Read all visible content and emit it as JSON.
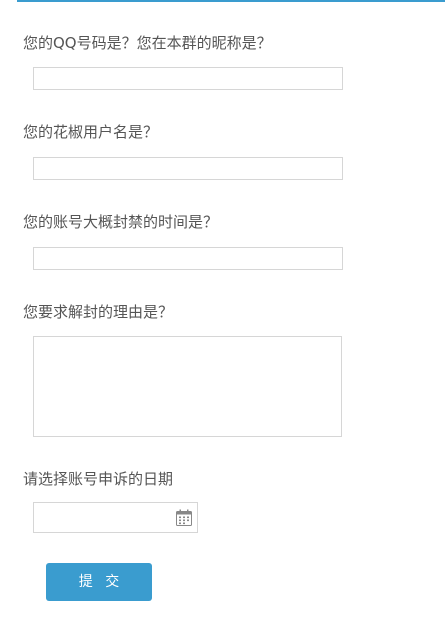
{
  "form": {
    "questions": [
      {
        "label": "您的QQ号码是？您在本群的昵称是？",
        "value": "",
        "placeholder": ""
      },
      {
        "label": "您的花椒用户名是？",
        "value": "",
        "placeholder": ""
      },
      {
        "label": "您的账号大概封禁的时间是？",
        "value": "",
        "placeholder": ""
      },
      {
        "label": "您要求解封的理由是？",
        "value": "",
        "placeholder": ""
      },
      {
        "label": "请选择账号申诉的日期",
        "value": "",
        "placeholder": ""
      }
    ],
    "submit_label": "提 交",
    "date_icon": "calendar-icon"
  },
  "colors": {
    "accent": "#3a9ccf",
    "label_text": "#555555",
    "border": "#d6d6d6"
  }
}
